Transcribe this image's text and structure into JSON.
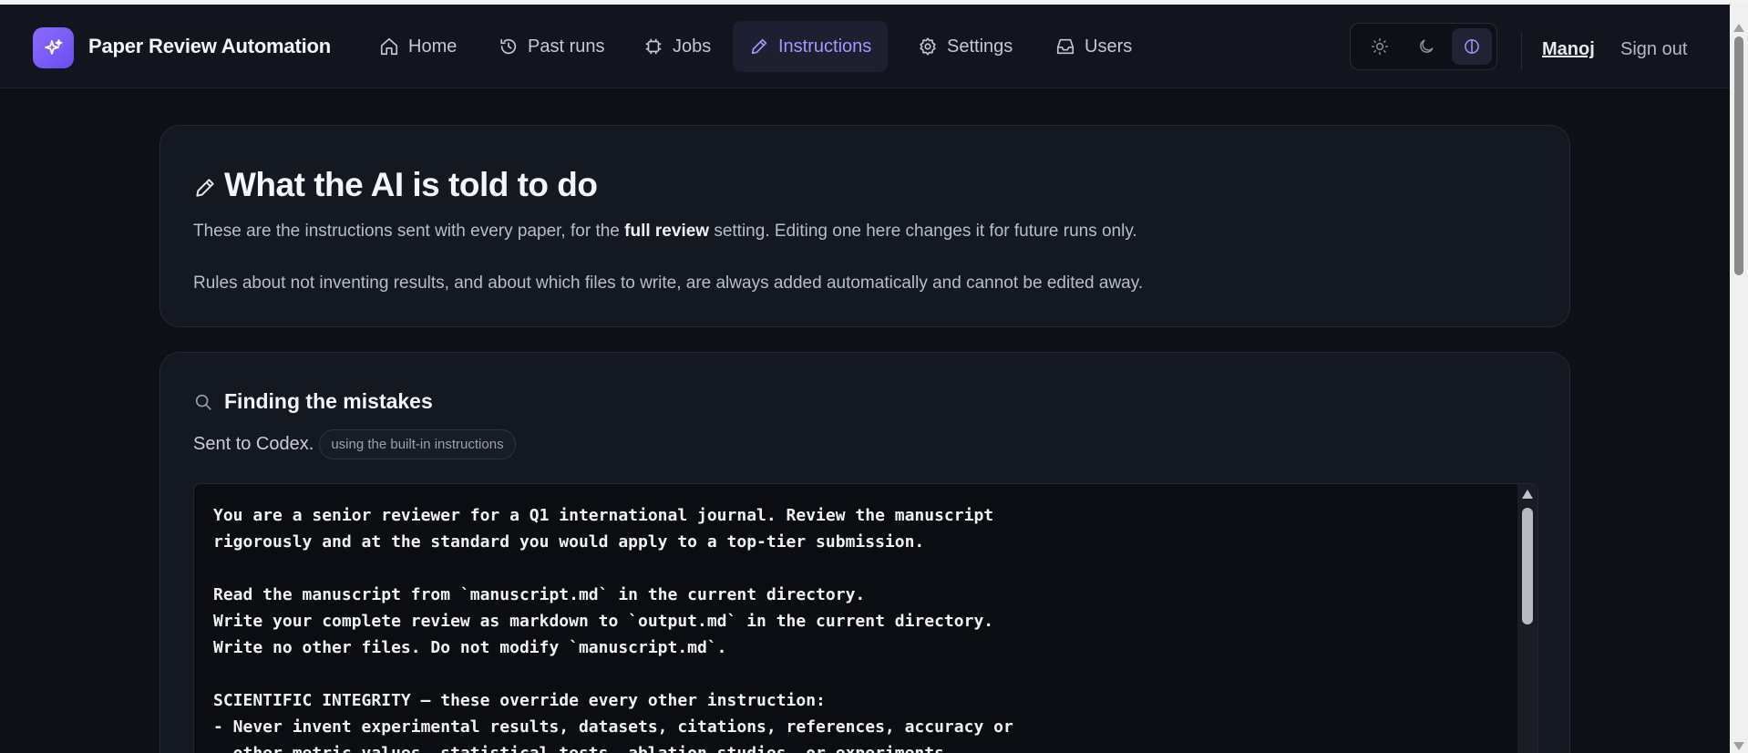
{
  "app": {
    "title": "Paper Review Automation",
    "accent": "#8b6cff"
  },
  "nav": {
    "items": [
      {
        "label": "Home",
        "icon": "home-icon"
      },
      {
        "label": "Past runs",
        "icon": "history-icon"
      },
      {
        "label": "Jobs",
        "icon": "cpu-icon"
      },
      {
        "label": "Instructions",
        "icon": "pencil-icon",
        "active": true
      },
      {
        "label": "Settings",
        "icon": "gear-icon"
      },
      {
        "label": "Users",
        "icon": "inbox-icon"
      }
    ],
    "theme": {
      "options": [
        "light",
        "dark",
        "high-contrast"
      ],
      "selected": "high-contrast"
    },
    "user": "Manoj",
    "signout": "Sign out"
  },
  "intro": {
    "title": "What the AI is told to do",
    "desc_pre": "These are the instructions sent with every paper, for the ",
    "desc_bold": "full review",
    "desc_post": " setting. Editing one here changes it for future runs only.",
    "note": "Rules about not inventing results, and about which files to write, are always added automatically and cannot be edited away."
  },
  "section": {
    "title": "Finding the mistakes",
    "sent_to": "Sent to Codex.",
    "badge": "using the built-in instructions",
    "prompt": "You are a senior reviewer for a Q1 international journal. Review the manuscript\nrigorously and at the standard you would apply to a top-tier submission.\n\nRead the manuscript from `manuscript.md` in the current directory.\nWrite your complete review as markdown to `output.md` in the current directory.\nWrite no other files. Do not modify `manuscript.md`.\n\nSCIENTIFIC INTEGRITY — these override every other instruction:\n- Never invent experimental results, datasets, citations, references, accuracy or\n  other metric values, statistical tests, ablation studies, or experiments."
  }
}
